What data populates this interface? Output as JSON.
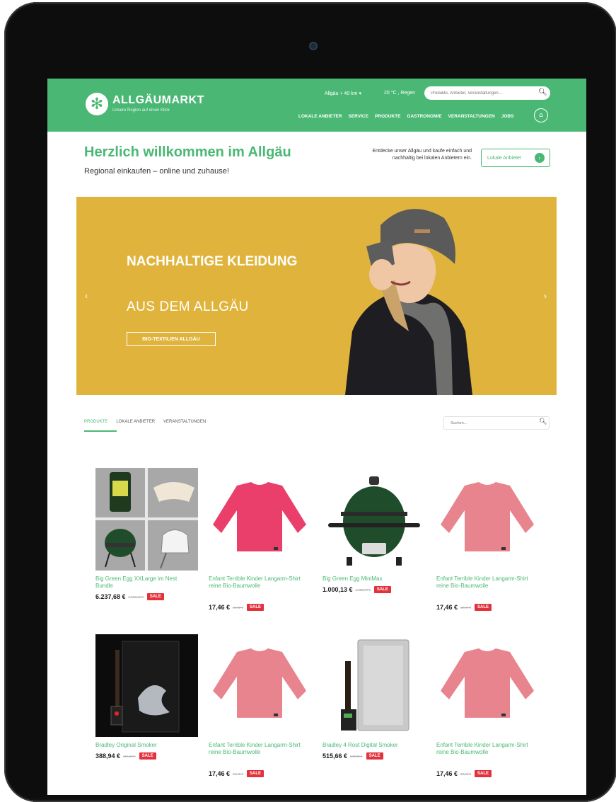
{
  "header": {
    "logo_name": "ALLGÄUMARKT",
    "logo_tagline": "Unsere Region auf einen Klick",
    "region_select": "Allgäu + 40 km ▾",
    "weather": "20 °C , Regen",
    "search_placeholder": "Produkte, Anbieter, Veranstaltungen...",
    "nav": [
      "LOKALE ANBIETER",
      "SERVICE",
      "PRODUKTE",
      "GASTRONOMIE",
      "VERANSTALTUNGEN",
      "JOBS"
    ]
  },
  "welcome": {
    "title": "Herzlich willkommen im Allgäu",
    "subtitle": "Regional einkaufen – online und zuhause!",
    "intro": "Entdecke unser Allgäu und kaufe einfach und nachhaltig bei lokalen Anbietern ein.",
    "button": "Lokale Anbieter"
  },
  "hero": {
    "line1": "NACHHALTIGE KLEIDUNG",
    "line2": "AUS DEM ALLGÄU",
    "button": "BIO-TEXTILIEN ALLGÄU",
    "bg_color": "#e0b43c"
  },
  "tabs": [
    "PRODUKTE",
    "LOKALE ANBIETER",
    "VERANSTALTUNGEN"
  ],
  "product_search_placeholder": "Suchen...",
  "sale_label": "SALE",
  "products": [
    {
      "name": "Big Green Egg XXLarge im Nest Bundle",
      "price": "6.237,68 €",
      "old_price": "6.563,19 €"
    },
    {
      "name": "Enfant Terrible Kinder Langarm-Shirt reine Bio-Baumwolle",
      "price": "17,46 €",
      "old_price": "19,40 €"
    },
    {
      "name": "Big Green Egg MiniMax",
      "price": "1.000,13 €",
      "old_price": "1.052,77 €"
    },
    {
      "name": "Enfant Terrible Kinder Langarm-Shirt reine Bio-Baumwolle",
      "price": "17,46 €",
      "old_price": "19,40 €"
    },
    {
      "name": "Bradley Original Smoker",
      "price": "388,94 €",
      "old_price": "410,15 €"
    },
    {
      "name": "Enfant Terrible Kinder Langarm-Shirt reine Bio-Baumwolle",
      "price": "17,46 €",
      "old_price": "19,40 €"
    },
    {
      "name": "Bradley 4 Rost Digital Smoker",
      "price": "515,66 €",
      "old_price": "543,39 €"
    },
    {
      "name": "Enfant Terrible Kinder Langarm-Shirt reine Bio-Baumwolle",
      "price": "17,46 €",
      "old_price": "19,40 €"
    }
  ],
  "colors": {
    "brand_green": "#4ab874",
    "sale_red": "#e2323c",
    "hero_yellow": "#e0b43c"
  }
}
